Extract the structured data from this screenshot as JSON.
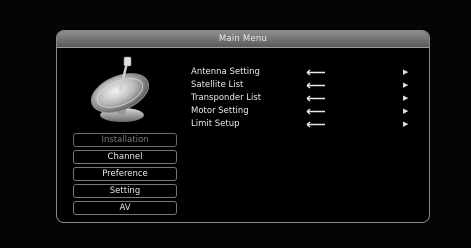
{
  "window": {
    "title": "Main Menu"
  },
  "side_menu": {
    "items": [
      {
        "label": "Installation",
        "active": true
      },
      {
        "label": "Channel",
        "active": false
      },
      {
        "label": "Preference",
        "active": false
      },
      {
        "label": "Setting",
        "active": false
      },
      {
        "label": "AV",
        "active": false
      }
    ]
  },
  "installation": {
    "items": [
      {
        "label": "Antenna Setting"
      },
      {
        "label": "Satellite List"
      },
      {
        "label": "Transponder List"
      },
      {
        "label": "Motor Setting"
      },
      {
        "label": "Limit Setup"
      }
    ]
  },
  "icons": {
    "dish": "satellite-dish-icon",
    "arrow": "return-arrow-icon",
    "chevron": "chevron-right-icon"
  }
}
